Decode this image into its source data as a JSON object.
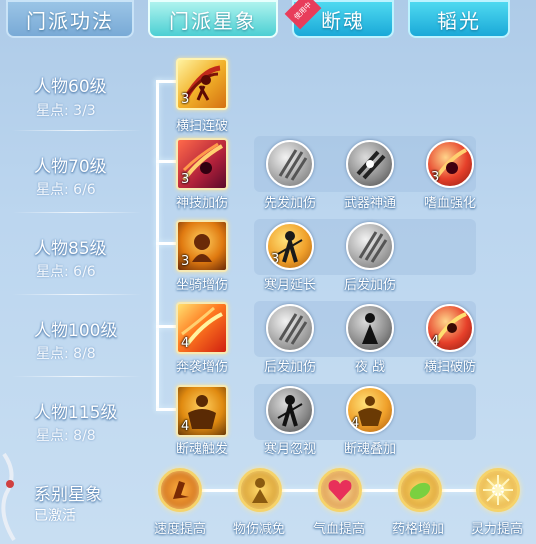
{
  "tabs": [
    {
      "label": "门派功法",
      "state": "inactive"
    },
    {
      "label": "门派星象",
      "state": "active"
    },
    {
      "label": "断魂",
      "state": "normal",
      "badge": "使用中"
    },
    {
      "label": "韬光",
      "state": "normal"
    }
  ],
  "rows": [
    {
      "level": "人物60级",
      "stars": "星点: 3/3",
      "skills": [
        {
          "label": "横扫连破",
          "count": "3"
        }
      ]
    },
    {
      "level": "人物70级",
      "stars": "星点: 6/6",
      "skills": [
        {
          "label": "神技加伤",
          "count": "3"
        },
        {
          "label": "先发加伤",
          "count": ""
        },
        {
          "label": "武器神通",
          "count": ""
        },
        {
          "label": "嗜血强化",
          "count": "3"
        }
      ]
    },
    {
      "level": "人物85级",
      "stars": "星点: 6/6",
      "skills": [
        {
          "label": "坐骑增伤",
          "count": "3"
        },
        {
          "label": "寒月延长",
          "count": "3"
        },
        {
          "label": "后发加伤",
          "count": ""
        }
      ]
    },
    {
      "level": "人物100级",
      "stars": "星点: 8/8",
      "skills": [
        {
          "label": "奔袭增伤",
          "count": "4"
        },
        {
          "label": "后发加伤",
          "count": ""
        },
        {
          "label": "夜 战",
          "count": ""
        },
        {
          "label": "横扫破防",
          "count": "4"
        }
      ]
    },
    {
      "level": "人物115级",
      "stars": "星点: 8/8",
      "skills": [
        {
          "label": "断魂触发",
          "count": "4"
        },
        {
          "label": "寒月忽视",
          "count": ""
        },
        {
          "label": "断魂叠加",
          "count": "4"
        }
      ]
    }
  ],
  "constellation": {
    "title": "系别星象",
    "status": "已激活",
    "items": [
      "速度提高",
      "物伤减免",
      "气血提高",
      "药格增加",
      "灵力提高"
    ]
  },
  "colors": {
    "accent": "#4ccfd3",
    "tab_cyan": "#1aa9d8",
    "gold": "#f6d36a"
  }
}
